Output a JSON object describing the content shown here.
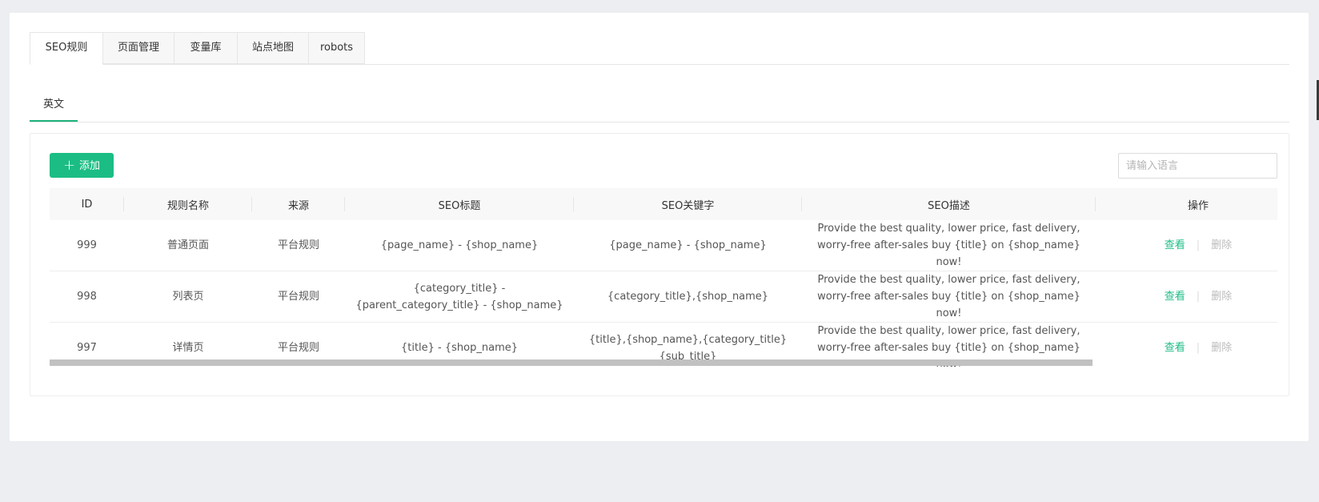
{
  "tabs": [
    {
      "label": "SEO规则",
      "active": true
    },
    {
      "label": "页面管理",
      "active": false
    },
    {
      "label": "变量库",
      "active": false
    },
    {
      "label": "站点地图",
      "active": false
    },
    {
      "label": "robots",
      "active": false
    }
  ],
  "lang_tabs": [
    {
      "label": "英文",
      "active": true
    }
  ],
  "toolbar": {
    "add_label": "添加",
    "add_icon": "plus-icon",
    "search_placeholder": "请输入语言"
  },
  "colors": {
    "accent": "#1cbd85",
    "delete_link": "#bbbbbb"
  },
  "table": {
    "columns": [
      "ID",
      "规则名称",
      "来源",
      "SEO标题",
      "SEO关键字",
      "SEO描述",
      "操作"
    ],
    "rows": [
      {
        "id": "999",
        "name": "普通页面",
        "source": "平台规则",
        "seo_title": "{page_name} - {shop_name}",
        "seo_keywords": "{page_name} - {shop_name}",
        "seo_desc": "Provide the best quality, lower price, fast delivery, worry-free after-sales buy {title} on {shop_name} now!",
        "view_label": "查看",
        "delete_label": "删除"
      },
      {
        "id": "998",
        "name": "列表页",
        "source": "平台规则",
        "seo_title": "{category_title} - {parent_category_title} - {shop_name}",
        "seo_keywords": "{category_title},{shop_name}",
        "seo_desc": "Provide the best quality, lower price, fast delivery, worry-free after-sales buy {title} on {shop_name} now!",
        "view_label": "查看",
        "delete_label": "删除"
      },
      {
        "id": "997",
        "name": "详情页",
        "source": "平台规则",
        "seo_title": "{title} - {shop_name}",
        "seo_keywords": "{title},{shop_name},{category_title}{sub_title}",
        "seo_desc": "Provide the best quality, lower price, fast delivery, worry-free after-sales buy {title} on {shop_name} now!",
        "view_label": "查看",
        "delete_label": "删除"
      }
    ]
  }
}
